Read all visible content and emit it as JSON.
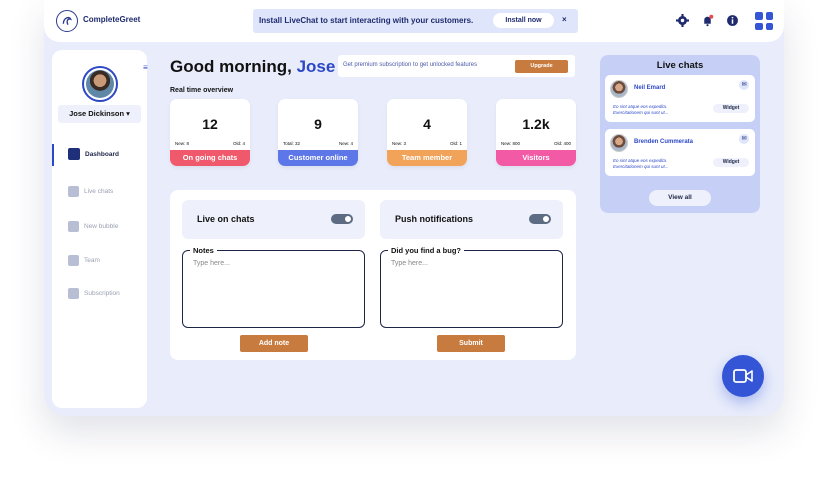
{
  "brand": {
    "name": "CompleteGreet"
  },
  "banner": {
    "text": "Install LiveChat to start interacting with your customers.",
    "install_label": "Install now",
    "close": "×"
  },
  "header_icons": [
    "gear-icon",
    "bell-icon",
    "info-icon",
    "apps-grid-icon"
  ],
  "user": {
    "name": "Jose Dickinson ▾"
  },
  "sidebar": {
    "items": [
      {
        "label": "Dashboard",
        "icon": "dashboard-icon",
        "active": true
      },
      {
        "label": "Live chats",
        "icon": "chat-icon",
        "active": false
      },
      {
        "label": "New bubble",
        "icon": "bubble-icon",
        "active": false
      },
      {
        "label": "Team",
        "icon": "team-icon",
        "active": false
      },
      {
        "label": "Subscription",
        "icon": "card-icon",
        "active": false
      }
    ]
  },
  "greeting": {
    "prefix": "Good morning,",
    "name": "Jose"
  },
  "premium": {
    "text": "Get premium subscription to get unlocked features",
    "button": "Upgrade"
  },
  "overview": {
    "title": "Real time overview",
    "stats": [
      {
        "value": "12",
        "left": "New: 8",
        "right": "Old: 4",
        "label": "On going chats",
        "color": "#f0596c"
      },
      {
        "value": "9",
        "left": "Total: 32",
        "right": "New: 4",
        "label": "Customer online",
        "color": "#5d76e8"
      },
      {
        "value": "4",
        "left": "New: 3",
        "right": "Old: 1",
        "label": "Team member",
        "color": "#f2a35a"
      },
      {
        "value": "1.2k",
        "left": "New: 800",
        "right": "Old: 400",
        "label": "Visitors",
        "color": "#f25aa6"
      }
    ]
  },
  "toggles": {
    "live_on_chats": "Live on chats",
    "push_notifications": "Push notifications"
  },
  "notes": {
    "legend": "Notes",
    "placeholder": "Type here...",
    "button": "Add note"
  },
  "bug": {
    "legend": "Did you find a bug?",
    "placeholder": "Type here...",
    "button": "Submit"
  },
  "live_chats": {
    "title": "Live chats",
    "chats": [
      {
        "name": "Neil Emard",
        "msg1": "Eo sint atque eos expedita.",
        "msg2": "Exercitationem qui sunt ut...",
        "widget": "Widget"
      },
      {
        "name": "Brenden Cummerata",
        "msg1": "Eo sint atque eos expedita.",
        "msg2": "Exercitationem qui sunt ut...",
        "widget": "Widget"
      }
    ],
    "view_all": "View all"
  }
}
